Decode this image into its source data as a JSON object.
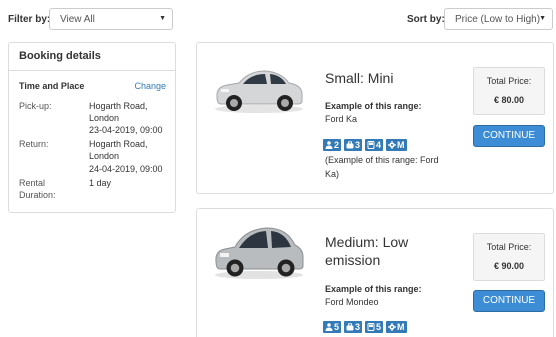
{
  "filter": {
    "label": "Filter by:",
    "value": "View All"
  },
  "sort": {
    "label": "Sort by:",
    "value": "Price (Low to High)"
  },
  "booking": {
    "title": "Booking details",
    "section_title": "Time and Place",
    "change_link": "Change",
    "pickup_label": "Pick-up:",
    "pickup_place_1": "Hogarth Road,",
    "pickup_place_2": "London",
    "pickup_datetime": "23-04-2019, 09:00",
    "return_label": "Return:",
    "return_place_1": "Hogarth Road,",
    "return_place_2": "London",
    "return_datetime": "24-04-2019, 09:00",
    "duration_label_1": "Rental",
    "duration_label_2": "Duration:",
    "duration_value": "1 day"
  },
  "cars": [
    {
      "title": "Small: Mini",
      "example_label": "Example of this range:",
      "example_model": "Ford Ka",
      "features": {
        "seats": "2",
        "bags": "3",
        "doors": "4",
        "transmission": "M"
      },
      "feature_note": "(Example of this range: Ford Ka)",
      "price_label": "Total Price:",
      "price": "€ 80.00",
      "continue_label": "CONTINUE",
      "body_color": "#d4d6d8"
    },
    {
      "title_line1": "Medium: Low",
      "title_line2": "emission",
      "example_label": "Example of this range:",
      "example_model": "Ford Mondeo",
      "features": {
        "seats": "5",
        "bags": "3",
        "doors": "5",
        "transmission": "M"
      },
      "price_label": "Total Price:",
      "price": "€ 90.00",
      "continue_label": "CONTINUE",
      "body_color": "#b9bcbf"
    }
  ],
  "colors": {
    "accent": "#337ab7",
    "button": "#3c8dd6",
    "panel_border": "#dddddd",
    "price_bg": "#f5f5f5"
  },
  "icons": [
    "person-icon",
    "suitcase-icon",
    "door-icon",
    "gear-icon",
    "caret-down-icon"
  ]
}
